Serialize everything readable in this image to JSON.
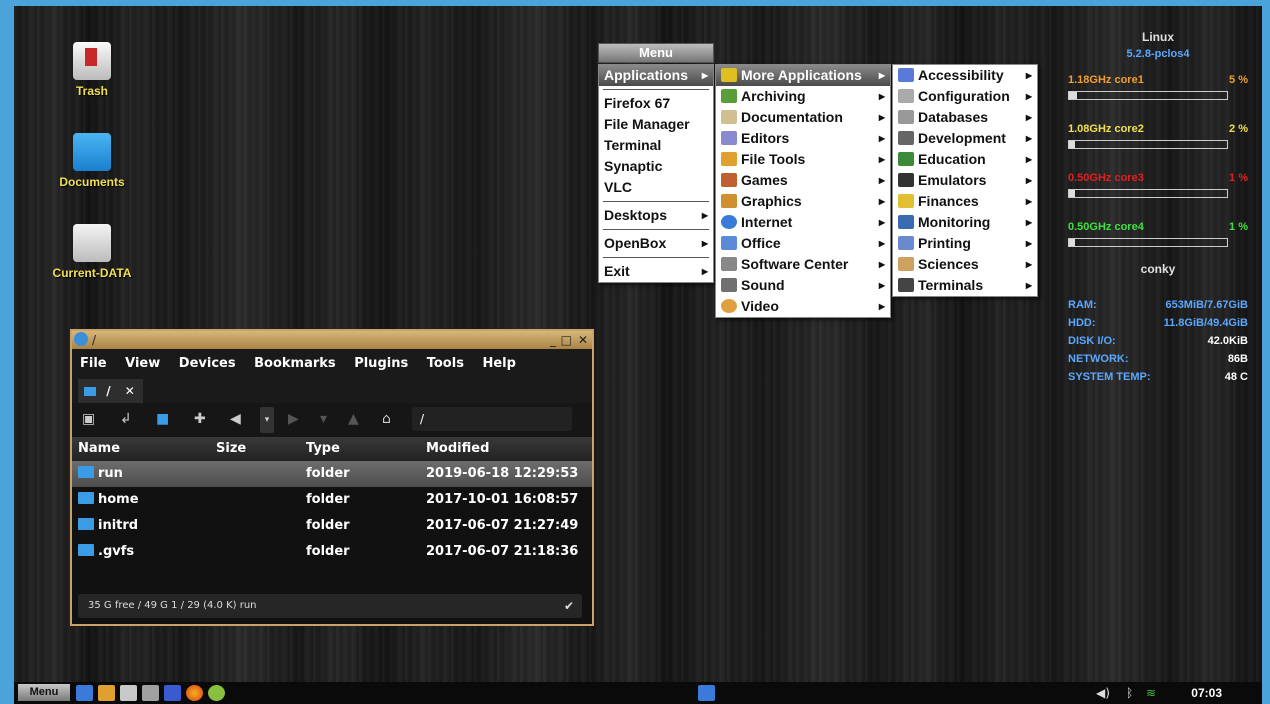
{
  "desktop": {
    "icons": [
      {
        "label": "Trash",
        "icon": "trash-icon"
      },
      {
        "label": "Documents",
        "icon": "folder-icon"
      },
      {
        "label": "Current-DATA",
        "icon": "drive-icon"
      }
    ]
  },
  "menu": {
    "title": "Menu",
    "main": {
      "applications": "Applications",
      "favorites": [
        "Firefox 67",
        "File Manager",
        "Terminal",
        "Synaptic",
        "VLC"
      ],
      "desktops": "Desktops",
      "openbox": "OpenBox",
      "exit": "Exit"
    },
    "apps": {
      "more": "More Applications",
      "items": [
        "Archiving",
        "Documentation",
        "Editors",
        "File Tools",
        "Games",
        "Graphics",
        "Internet",
        "Office",
        "Software Center",
        "Sound",
        "Video"
      ]
    },
    "more": {
      "items": [
        "Accessibility",
        "Configuration",
        "Databases",
        "Development",
        "Education",
        "Emulators",
        "Finances",
        "Monitoring",
        "Printing",
        "Sciences",
        "Terminals"
      ]
    }
  },
  "conky": {
    "os": "Linux",
    "kernel": "5.2.8-pclos4",
    "cores": [
      {
        "label": "1.18GHz  core1",
        "percent_text": "5 %",
        "usage": 0.05,
        "color": "#f0a030"
      },
      {
        "label": "1.08GHz  core2",
        "percent_text": "2 %",
        "usage": 0.02,
        "color": "#f0e050"
      },
      {
        "label": "0.50GHz  core3",
        "percent_text": "1 %",
        "usage": 0.01,
        "color": "#e02020"
      },
      {
        "label": "0.50GHz  core4",
        "percent_text": "1 %",
        "usage": 0.01,
        "color": "#40e040"
      }
    ],
    "name": "conky",
    "stats": [
      {
        "label": "RAM:",
        "value": "653MiB/7.67GiB"
      },
      {
        "label": "HDD:",
        "value": "11.8GiB/49.4GiB"
      },
      {
        "label": "DISK I/O:",
        "value": "42.0KiB"
      },
      {
        "label": "NETWORK:",
        "value": "86B"
      },
      {
        "label": "SYSTEM TEMP:",
        "value": "48 C"
      }
    ]
  },
  "filemanager": {
    "title": "/",
    "window_controls": {
      "minimize": "_",
      "maximize": "□",
      "close": "✕"
    },
    "menus": [
      "File",
      "View",
      "Devices",
      "Bookmarks",
      "Plugins",
      "Tools",
      "Help"
    ],
    "tab": {
      "label": "/",
      "close": "✕"
    },
    "path": "/",
    "columns": [
      "Name",
      "Size",
      "Type",
      "Modified"
    ],
    "rows": [
      {
        "name": "run",
        "size": "",
        "type": "folder",
        "modified": "2019-06-18 12:29:53"
      },
      {
        "name": "home",
        "size": "",
        "type": "folder",
        "modified": "2017-10-01 16:08:57"
      },
      {
        "name": "initrd",
        "size": "",
        "type": "folder",
        "modified": "2017-06-07 21:27:49"
      },
      {
        "name": ".gvfs",
        "size": "",
        "type": "folder",
        "modified": "2017-06-07 21:18:36"
      }
    ],
    "status": "35 G free / 49 G   1 / 29 (4.0 K)   run"
  },
  "taskbar": {
    "menu_label": "Menu",
    "clock": "07:03"
  }
}
